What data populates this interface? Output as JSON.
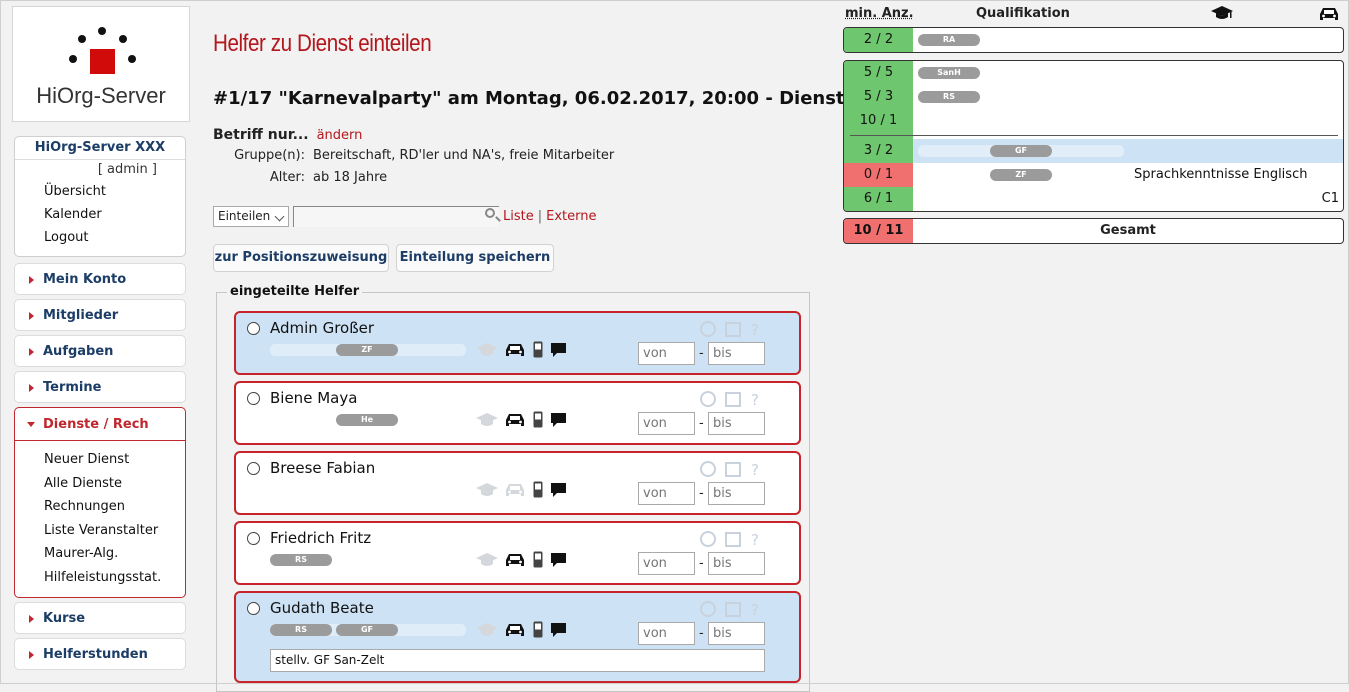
{
  "logo": {
    "text": "HiOrg-Server"
  },
  "user_box": {
    "org": "HiOrg-Server XXX",
    "admin": "[ admin ]",
    "links": [
      "Übersicht",
      "Kalender",
      "Logout"
    ]
  },
  "menu": {
    "items_top": [
      "Mein Konto",
      "Mitglieder",
      "Aufgaben",
      "Termine"
    ],
    "open": {
      "label": "Dienste / Rech",
      "sub": [
        "Neuer Dienst",
        "Alle Dienste",
        "Rechnungen",
        "Liste Veranstalter",
        "Maurer-Alg.",
        "Hilfeleistungsstat."
      ]
    },
    "items_bottom": [
      "Kurse",
      "Helferstunden"
    ]
  },
  "page": {
    "heading": "Helfer zu Dienst einteilen",
    "event_title": "#1/17 \"Karnevalparty\" am Montag, 06.02.2017, 20:00 - Dienst",
    "betrifft_label": "Betriff nur...",
    "betrifft_link": "ändern",
    "gruppe_label": "Gruppe(n):",
    "gruppe_value": "Bereitschaft, RD'ler und NA's, freie Mitarbeiter",
    "alter_label": "Alter:",
    "alter_value": "ab 18 Jahre"
  },
  "toolbar": {
    "select_value": "Einteilen",
    "search_value": "",
    "link_liste": "Liste",
    "separator": "|",
    "link_externe": "Externe"
  },
  "buttons": {
    "position": "zur Positionszuweisung",
    "save": "Einteilung speichern"
  },
  "helpers": {
    "legend": "eingeteilte Helfer",
    "from_placeholder": "von",
    "to_placeholder": "bis",
    "dash": "-",
    "list": [
      {
        "name": "Admin Großer",
        "badges": [
          "ZF"
        ],
        "selected": true,
        "car": true,
        "note": ""
      },
      {
        "name": "Biene Maya",
        "badges": [
          "He"
        ],
        "selected": false,
        "car": true,
        "note": ""
      },
      {
        "name": "Breese Fabian",
        "badges": [],
        "selected": false,
        "car": false,
        "note": ""
      },
      {
        "name": "Friedrich Fritz",
        "badges": [
          "RS"
        ],
        "selected": false,
        "car": true,
        "note": ""
      },
      {
        "name": "Gudath Beate",
        "badges": [
          "RS",
          "GF"
        ],
        "selected": true,
        "car": true,
        "note": "stellv. GF San-Zelt"
      }
    ]
  },
  "requirements": {
    "col_min": "min. Anz.",
    "col_qual": "Qualifikation",
    "group1": [
      {
        "count": "2 / 2",
        "qual": "RA",
        "status": "ok"
      }
    ],
    "group2a": [
      {
        "count": "5 / 5",
        "qual": "SanH",
        "status": "ok"
      },
      {
        "count": "5 / 3",
        "qual": "RS",
        "status": "ok"
      },
      {
        "count": "10 / 1",
        "qual": "",
        "status": "ok"
      }
    ],
    "group2b": [
      {
        "count": "3 / 2",
        "qual": "GF",
        "status": "ok",
        "extra": "",
        "highlight": true
      },
      {
        "count": "0 / 1",
        "qual": "ZF",
        "status": "missing",
        "extra": "Sprachkenntnisse Englisch"
      },
      {
        "count": "6 / 1",
        "qual": "",
        "status": "ok",
        "extra": "C1"
      }
    ],
    "total": {
      "count": "10 / 11",
      "label": "Gesamt",
      "status": "missing"
    }
  },
  "colors": {
    "accent": "#b3171d",
    "navy": "#1c3d66",
    "ok": "#6ec76e",
    "missing": "#f07070",
    "selected": "#cde3f5"
  }
}
